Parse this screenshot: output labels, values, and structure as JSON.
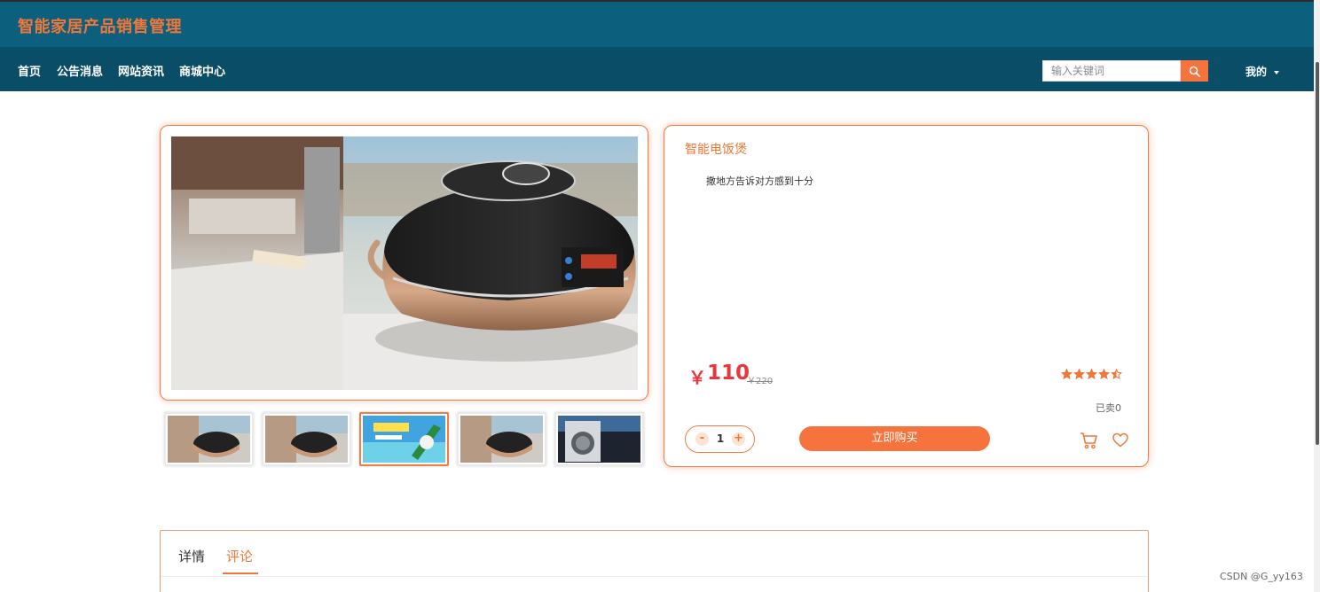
{
  "header": {
    "site_title": "智能家居产品销售管理",
    "nav": [
      "首页",
      "公告消息",
      "网站资讯",
      "商城中心"
    ],
    "search_placeholder": "输入关键词",
    "user_menu_label": "我的",
    "colors": {
      "header_bg": "#0c5f7d",
      "nav_bg": "#0a4d67",
      "accent": "#f7733d"
    }
  },
  "gallery": {
    "main_image": "rice-cooker-photo",
    "thumbnails": [
      {
        "name": "rice-cooker-thumb-1",
        "active": false
      },
      {
        "name": "rice-cooker-thumb-2",
        "active": false
      },
      {
        "name": "promo-banner-thumb",
        "active": true
      },
      {
        "name": "rice-cooker-thumb-4",
        "active": false
      },
      {
        "name": "washing-machine-thumb",
        "active": false
      }
    ]
  },
  "product": {
    "name": "智能电饭煲",
    "description": "撒地方告诉对方感到十分",
    "price_symbol": "￥",
    "price": "110",
    "original_price": "￥220",
    "rating": 4.5,
    "rating_max": 5,
    "sold_label": "已卖0",
    "quantity": "1",
    "minus_label": "-",
    "plus_label": "+",
    "buy_label": "立即购买",
    "cart_icon": "cart-icon",
    "favorite_icon": "heart-icon"
  },
  "tabs": [
    {
      "label": "详情",
      "active": false
    },
    {
      "label": "评论",
      "active": true
    }
  ],
  "watermark": "CSDN @G_yy163"
}
